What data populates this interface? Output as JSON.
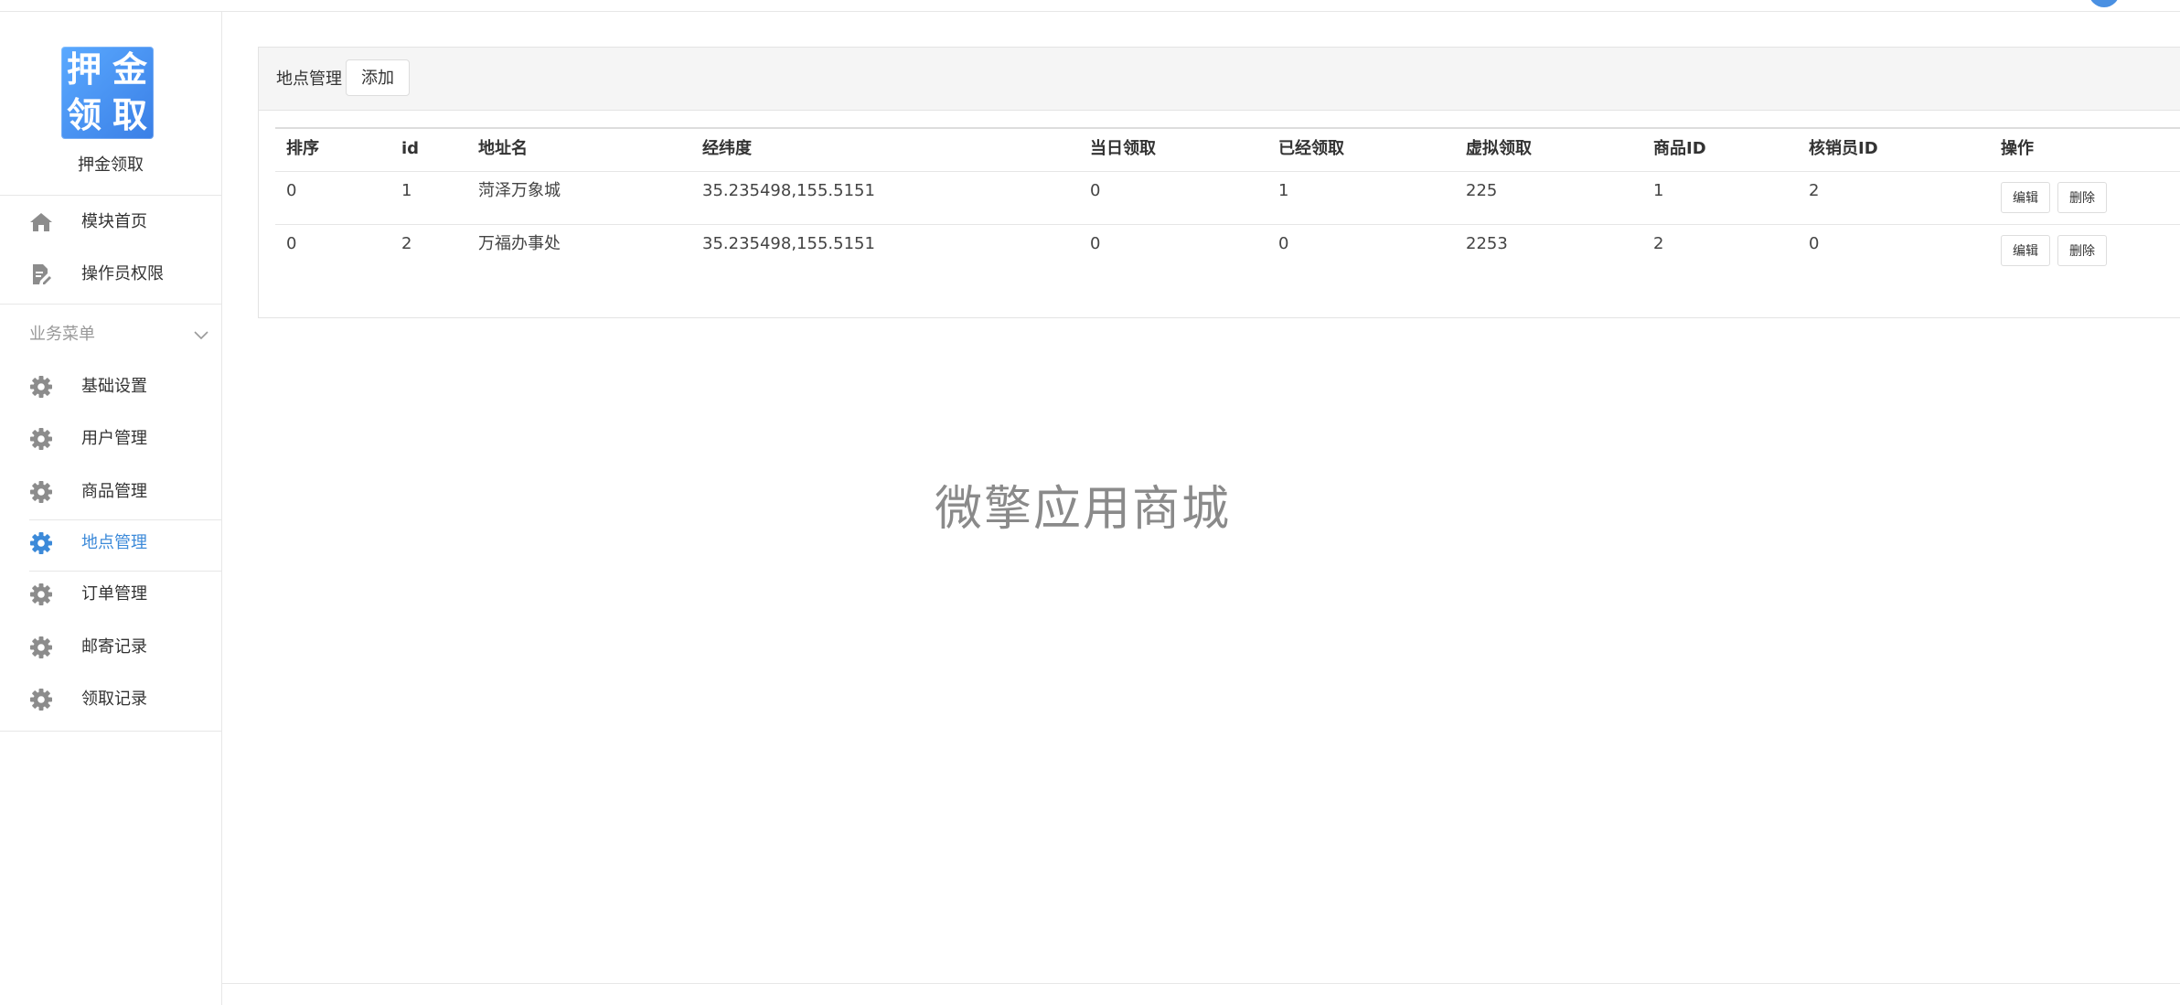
{
  "sidebar": {
    "logo_chars": [
      "押",
      "金",
      "领",
      "取"
    ],
    "app_title": "押金领取",
    "top_items": [
      {
        "label": "模块首页",
        "icon": "home-icon"
      },
      {
        "label": "操作员权限",
        "icon": "document-edit-icon"
      }
    ],
    "section_title": "业务菜单",
    "menu_items": [
      {
        "label": "基础设置",
        "icon": "gear-icon"
      },
      {
        "label": "用户管理",
        "icon": "gear-icon"
      },
      {
        "label": "商品管理",
        "icon": "gear-icon"
      },
      {
        "label": "地点管理",
        "icon": "gear-icon",
        "active": true
      },
      {
        "label": "订单管理",
        "icon": "gear-icon"
      },
      {
        "label": "邮寄记录",
        "icon": "gear-icon"
      },
      {
        "label": "领取记录",
        "icon": "gear-icon"
      }
    ]
  },
  "panel": {
    "title": "地点管理",
    "add_label": "添加"
  },
  "table": {
    "columns": [
      "排序",
      "id",
      "地址名",
      "经纬度",
      "当日领取",
      "已经领取",
      "虚拟领取",
      "商品ID",
      "核销员ID",
      "操作"
    ],
    "rows": [
      [
        "0",
        "1",
        "菏泽万象城",
        "35.235498,155.5151",
        "0",
        "1",
        "225",
        "1",
        "2"
      ],
      [
        "0",
        "2",
        "万福办事处",
        "35.235498,155.5151",
        "0",
        "0",
        "2253",
        "2",
        "0"
      ]
    ],
    "edit_label": "编辑",
    "delete_label": "删除"
  },
  "watermark": "微擎应用商城",
  "colors": {
    "accent": "#3c8ad9",
    "icon_gray": "#8c8c8c"
  }
}
